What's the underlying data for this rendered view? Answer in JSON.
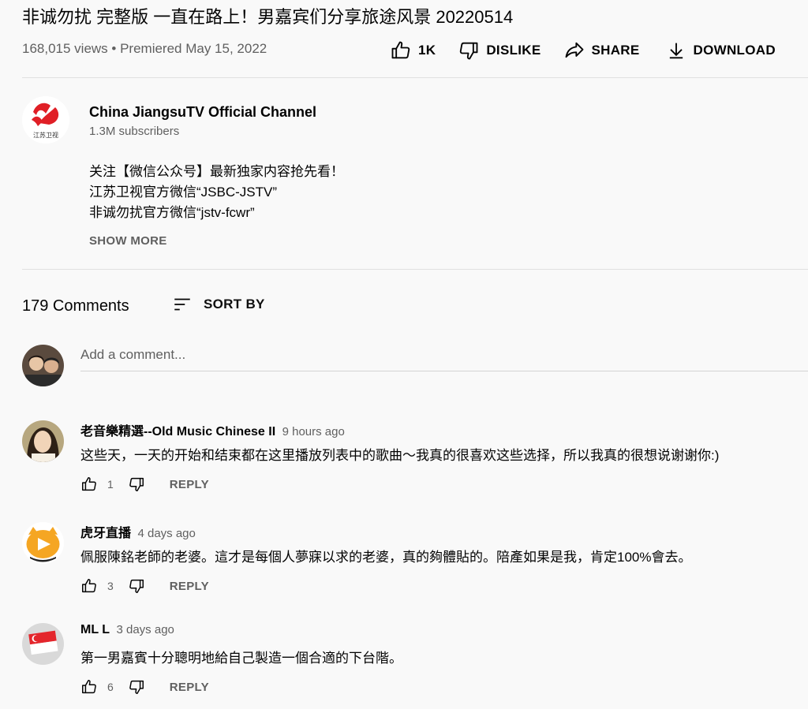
{
  "video": {
    "title": "非诚勿扰 完整版 一直在路上！男嘉宾们分享旅途风景 20220514",
    "meta": "168,015 views • Premiered May 15, 2022"
  },
  "actions": {
    "like_count": "1K",
    "dislike_label": "DISLIKE",
    "share_label": "SHARE",
    "download_label": "DOWNLOAD"
  },
  "channel": {
    "name": "China JiangsuTV Official Channel",
    "subscribers": "1.3M subscribers",
    "logo_text": "江苏卫视",
    "brand_color": "#e01f26"
  },
  "description": {
    "lines": [
      "关注【微信公众号】最新独家内容抢先看！",
      "江苏卫视官方微信“JSBC-JSTV”",
      "非诚勿扰官方微信“jstv-fcwr”"
    ],
    "show_more": "SHOW MORE"
  },
  "comments_section": {
    "count_label": "179 Comments",
    "sort_label": "SORT BY",
    "add_placeholder": "Add a comment..."
  },
  "comments": [
    {
      "author": "老音樂精選--Old Music Chinese II",
      "time": "9 hours ago",
      "text": "这些天，一天的开始和结束都在这里播放列表中的歌曲〜我真的很喜欢这些选择，所以我真的很想说谢谢你:)",
      "likes": "1",
      "reply_label": "REPLY"
    },
    {
      "author": "虎牙直播",
      "time": "4 days ago",
      "text": "佩服陳銘老師的老婆。這才是每個人夢寐以求的老婆，真的夠體貼的。陪產如果是我，肯定100%會去。",
      "likes": "3",
      "reply_label": "REPLY"
    },
    {
      "author": "ML L",
      "time": "3 days ago",
      "text": "第一男嘉賓十分聰明地給自己製造一個合適的下台階。",
      "likes": "6",
      "reply_label": "REPLY"
    }
  ]
}
